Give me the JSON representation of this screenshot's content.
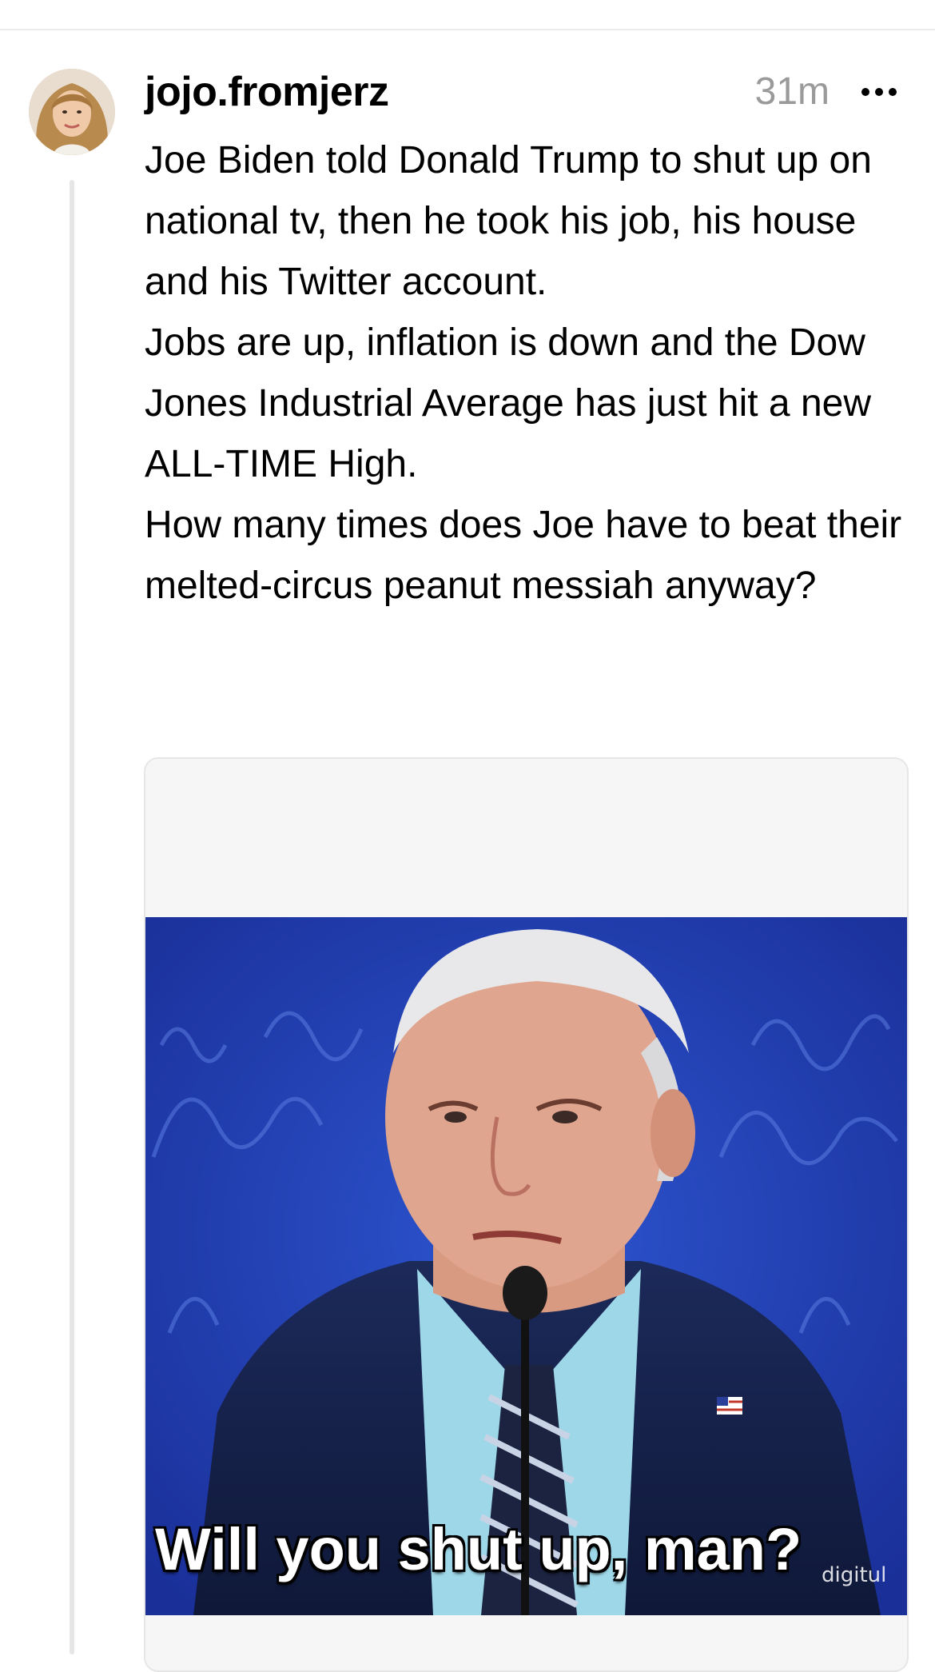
{
  "post": {
    "username": "jojo.fromjerz",
    "time": "31m",
    "paragraphs": [
      "Joe Biden told Donald Trump to shut up on national tv, then he took his job, his house and his Twitter account.",
      "Jobs are up, inflation is down and the Dow Jones Industrial Average has just hit a new ALL-TIME High.",
      "How many times does Joe have to beat their melted-circus peanut messiah anyway?"
    ],
    "more_icon": "ellipsis-icon",
    "media": {
      "caption": "Will you shut up, man?",
      "watermark": "digitul"
    }
  },
  "colors": {
    "text": "#000000",
    "muted": "#9a9a9a",
    "divider": "#e6e6e6",
    "meme_background": "#1f3fae"
  }
}
